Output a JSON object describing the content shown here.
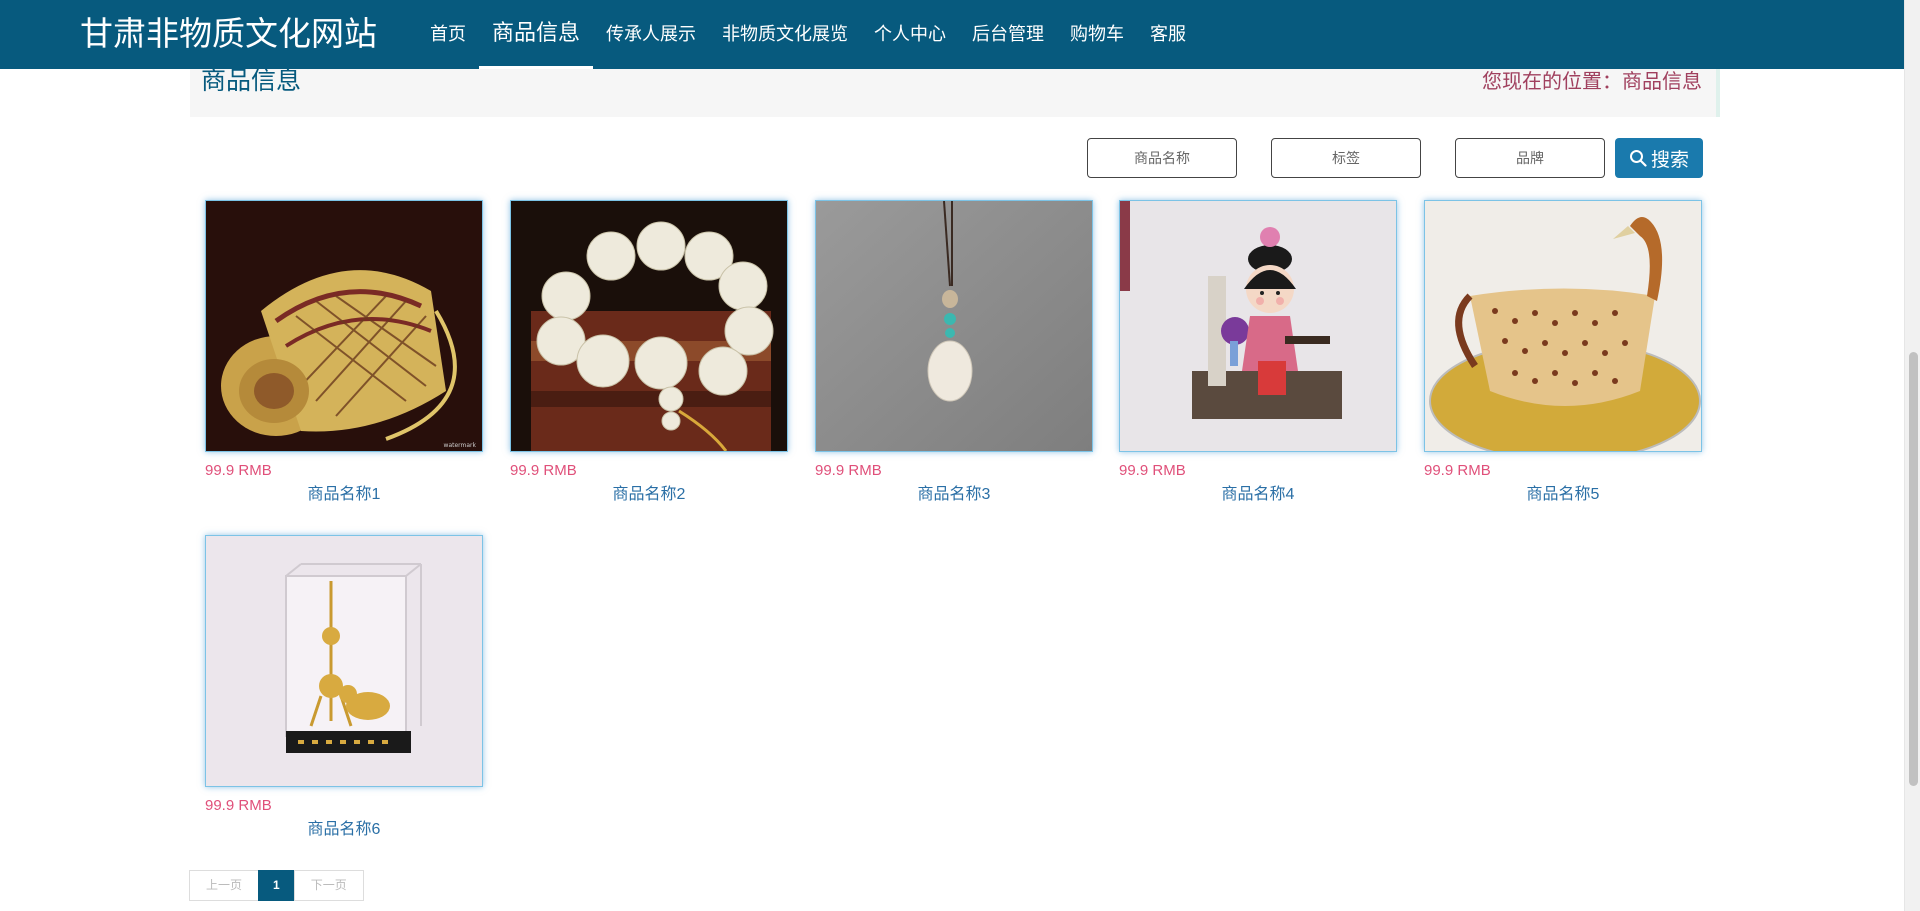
{
  "site": {
    "brand": "甘肃非物质文化网站"
  },
  "nav": [
    {
      "label": "首页",
      "active": false
    },
    {
      "label": "商品信息",
      "active": true
    },
    {
      "label": "传承人展示",
      "active": false
    },
    {
      "label": "非物质文化展览",
      "active": false
    },
    {
      "label": "个人中心",
      "active": false
    },
    {
      "label": "后台管理",
      "active": false
    },
    {
      "label": "购物车",
      "active": false
    },
    {
      "label": "客服",
      "active": false
    }
  ],
  "page": {
    "title": "商品信息",
    "location": "您现在的位置：商品信息"
  },
  "search": {
    "name_placeholder": "商品名称",
    "tag_placeholder": "标签",
    "brand_placeholder": "品牌",
    "button_label": "搜索"
  },
  "products": [
    {
      "price": "99.9 RMB",
      "name": "商品名称1",
      "image": "bamboo-woven-basket"
    },
    {
      "price": "99.9 RMB",
      "name": "商品名称2",
      "image": "bead-bracelet"
    },
    {
      "price": "99.9 RMB",
      "name": "商品名称3",
      "image": "jade-pendant"
    },
    {
      "price": "99.9 RMB",
      "name": "商品名称4",
      "image": "paper-doll-figurine"
    },
    {
      "price": "99.9 RMB",
      "name": "商品名称5",
      "image": "bamboo-swan-basket"
    },
    {
      "price": "99.9 RMB",
      "name": "商品名称6",
      "image": "tower-model-display"
    }
  ],
  "pagination": {
    "prev_label": "上一页",
    "current": "1",
    "next_label": "下一页"
  },
  "colors": {
    "nav_bg": "#075a7e",
    "price": "#e0507a",
    "name": "#2a6fa6",
    "location": "#a0405e",
    "search_button": "#1a7aad"
  }
}
